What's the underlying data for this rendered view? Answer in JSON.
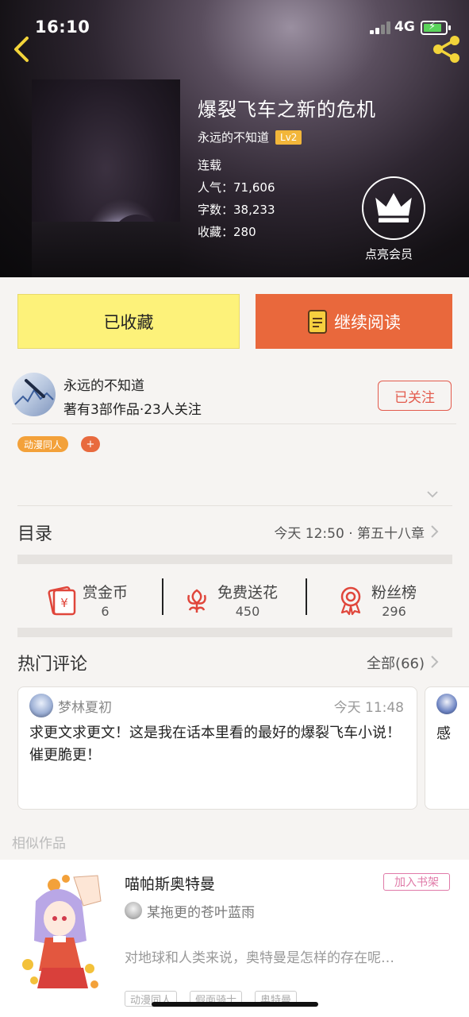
{
  "status_bar": {
    "time": "16:10",
    "network": "4G"
  },
  "book": {
    "title": "爆裂飞车之新的危机",
    "author": "永远的不知道",
    "level": "Lv2",
    "status": "连载",
    "popularity": "人气：71,606",
    "word_count": "字数：38,233",
    "favorites": "收藏：280",
    "vip_label": "点亮会员"
  },
  "actions": {
    "collected": "已收藏",
    "continue_reading": "继续阅读"
  },
  "author_info": {
    "name": "永远的不知道",
    "stats": "著有3部作品·23人关注",
    "follow": "已关注",
    "tag": "动漫同人",
    "add_tag": "+"
  },
  "toc": {
    "label": "目录",
    "latest": "今天 12:50 · 第五十八章"
  },
  "stats": [
    {
      "icon": "reward-coin-icon",
      "label": "赏金币",
      "value": "6"
    },
    {
      "icon": "flower-icon",
      "label": "免费送花",
      "value": "450"
    },
    {
      "icon": "ribbon-award-icon",
      "label": "粉丝榜",
      "value": "296"
    }
  ],
  "comments": {
    "label": "热门评论",
    "all": "全部(66)",
    "items": [
      {
        "user": "梦林夏初",
        "time": "今天 11:48",
        "text": "求更文求更文！这是我在话本里看的最好的爆裂飞车小说！催更脆更！"
      },
      {
        "user": "",
        "time": "",
        "text": "感"
      }
    ]
  },
  "similar": {
    "label": "相似作品",
    "items": [
      {
        "title": "喵帕斯奥特曼",
        "add_shelf": "加入书架",
        "author": "某拖更的苍叶蓝雨",
        "desc": "对地球和人类来说，奥特曼是怎样的存在呢…",
        "tags": [
          "动漫同人",
          "假面骑士",
          "奥特曼"
        ]
      }
    ]
  },
  "colors": {
    "accent_orange": "#e9683c",
    "collected_yellow": "#fdf27a",
    "follow_red": "#e35b4d",
    "level_gold": "#f2b63a",
    "share_yellow": "#f2d43a"
  }
}
